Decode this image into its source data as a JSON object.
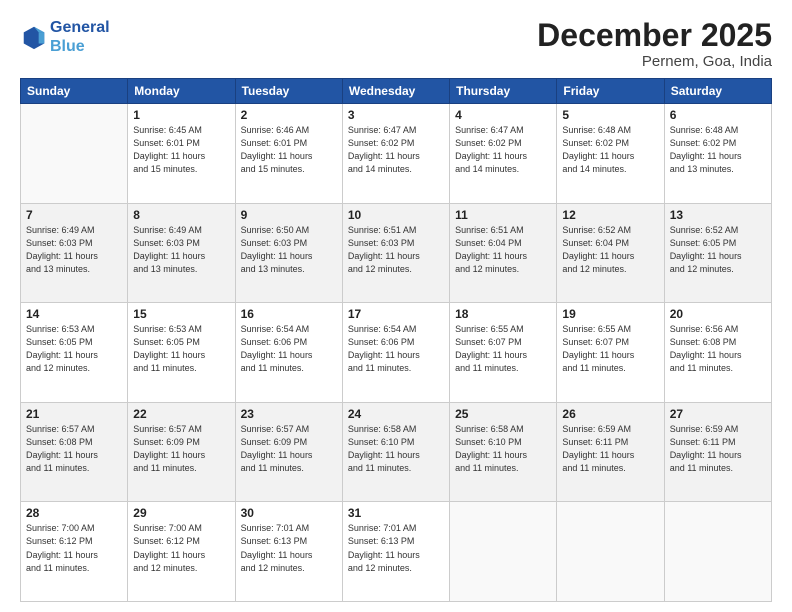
{
  "header": {
    "logo_line1": "General",
    "logo_line2": "Blue",
    "month": "December 2025",
    "location": "Pernem, Goa, India"
  },
  "days_of_week": [
    "Sunday",
    "Monday",
    "Tuesday",
    "Wednesday",
    "Thursday",
    "Friday",
    "Saturday"
  ],
  "weeks": [
    [
      {
        "num": "",
        "info": ""
      },
      {
        "num": "1",
        "info": "Sunrise: 6:45 AM\nSunset: 6:01 PM\nDaylight: 11 hours\nand 15 minutes."
      },
      {
        "num": "2",
        "info": "Sunrise: 6:46 AM\nSunset: 6:01 PM\nDaylight: 11 hours\nand 15 minutes."
      },
      {
        "num": "3",
        "info": "Sunrise: 6:47 AM\nSunset: 6:02 PM\nDaylight: 11 hours\nand 14 minutes."
      },
      {
        "num": "4",
        "info": "Sunrise: 6:47 AM\nSunset: 6:02 PM\nDaylight: 11 hours\nand 14 minutes."
      },
      {
        "num": "5",
        "info": "Sunrise: 6:48 AM\nSunset: 6:02 PM\nDaylight: 11 hours\nand 14 minutes."
      },
      {
        "num": "6",
        "info": "Sunrise: 6:48 AM\nSunset: 6:02 PM\nDaylight: 11 hours\nand 13 minutes."
      }
    ],
    [
      {
        "num": "7",
        "info": "Sunrise: 6:49 AM\nSunset: 6:03 PM\nDaylight: 11 hours\nand 13 minutes."
      },
      {
        "num": "8",
        "info": "Sunrise: 6:49 AM\nSunset: 6:03 PM\nDaylight: 11 hours\nand 13 minutes."
      },
      {
        "num": "9",
        "info": "Sunrise: 6:50 AM\nSunset: 6:03 PM\nDaylight: 11 hours\nand 13 minutes."
      },
      {
        "num": "10",
        "info": "Sunrise: 6:51 AM\nSunset: 6:03 PM\nDaylight: 11 hours\nand 12 minutes."
      },
      {
        "num": "11",
        "info": "Sunrise: 6:51 AM\nSunset: 6:04 PM\nDaylight: 11 hours\nand 12 minutes."
      },
      {
        "num": "12",
        "info": "Sunrise: 6:52 AM\nSunset: 6:04 PM\nDaylight: 11 hours\nand 12 minutes."
      },
      {
        "num": "13",
        "info": "Sunrise: 6:52 AM\nSunset: 6:05 PM\nDaylight: 11 hours\nand 12 minutes."
      }
    ],
    [
      {
        "num": "14",
        "info": "Sunrise: 6:53 AM\nSunset: 6:05 PM\nDaylight: 11 hours\nand 12 minutes."
      },
      {
        "num": "15",
        "info": "Sunrise: 6:53 AM\nSunset: 6:05 PM\nDaylight: 11 hours\nand 11 minutes."
      },
      {
        "num": "16",
        "info": "Sunrise: 6:54 AM\nSunset: 6:06 PM\nDaylight: 11 hours\nand 11 minutes."
      },
      {
        "num": "17",
        "info": "Sunrise: 6:54 AM\nSunset: 6:06 PM\nDaylight: 11 hours\nand 11 minutes."
      },
      {
        "num": "18",
        "info": "Sunrise: 6:55 AM\nSunset: 6:07 PM\nDaylight: 11 hours\nand 11 minutes."
      },
      {
        "num": "19",
        "info": "Sunrise: 6:55 AM\nSunset: 6:07 PM\nDaylight: 11 hours\nand 11 minutes."
      },
      {
        "num": "20",
        "info": "Sunrise: 6:56 AM\nSunset: 6:08 PM\nDaylight: 11 hours\nand 11 minutes."
      }
    ],
    [
      {
        "num": "21",
        "info": "Sunrise: 6:57 AM\nSunset: 6:08 PM\nDaylight: 11 hours\nand 11 minutes."
      },
      {
        "num": "22",
        "info": "Sunrise: 6:57 AM\nSunset: 6:09 PM\nDaylight: 11 hours\nand 11 minutes."
      },
      {
        "num": "23",
        "info": "Sunrise: 6:57 AM\nSunset: 6:09 PM\nDaylight: 11 hours\nand 11 minutes."
      },
      {
        "num": "24",
        "info": "Sunrise: 6:58 AM\nSunset: 6:10 PM\nDaylight: 11 hours\nand 11 minutes."
      },
      {
        "num": "25",
        "info": "Sunrise: 6:58 AM\nSunset: 6:10 PM\nDaylight: 11 hours\nand 11 minutes."
      },
      {
        "num": "26",
        "info": "Sunrise: 6:59 AM\nSunset: 6:11 PM\nDaylight: 11 hours\nand 11 minutes."
      },
      {
        "num": "27",
        "info": "Sunrise: 6:59 AM\nSunset: 6:11 PM\nDaylight: 11 hours\nand 11 minutes."
      }
    ],
    [
      {
        "num": "28",
        "info": "Sunrise: 7:00 AM\nSunset: 6:12 PM\nDaylight: 11 hours\nand 11 minutes."
      },
      {
        "num": "29",
        "info": "Sunrise: 7:00 AM\nSunset: 6:12 PM\nDaylight: 11 hours\nand 12 minutes."
      },
      {
        "num": "30",
        "info": "Sunrise: 7:01 AM\nSunset: 6:13 PM\nDaylight: 11 hours\nand 12 minutes."
      },
      {
        "num": "31",
        "info": "Sunrise: 7:01 AM\nSunset: 6:13 PM\nDaylight: 11 hours\nand 12 minutes."
      },
      {
        "num": "",
        "info": ""
      },
      {
        "num": "",
        "info": ""
      },
      {
        "num": "",
        "info": ""
      }
    ]
  ]
}
